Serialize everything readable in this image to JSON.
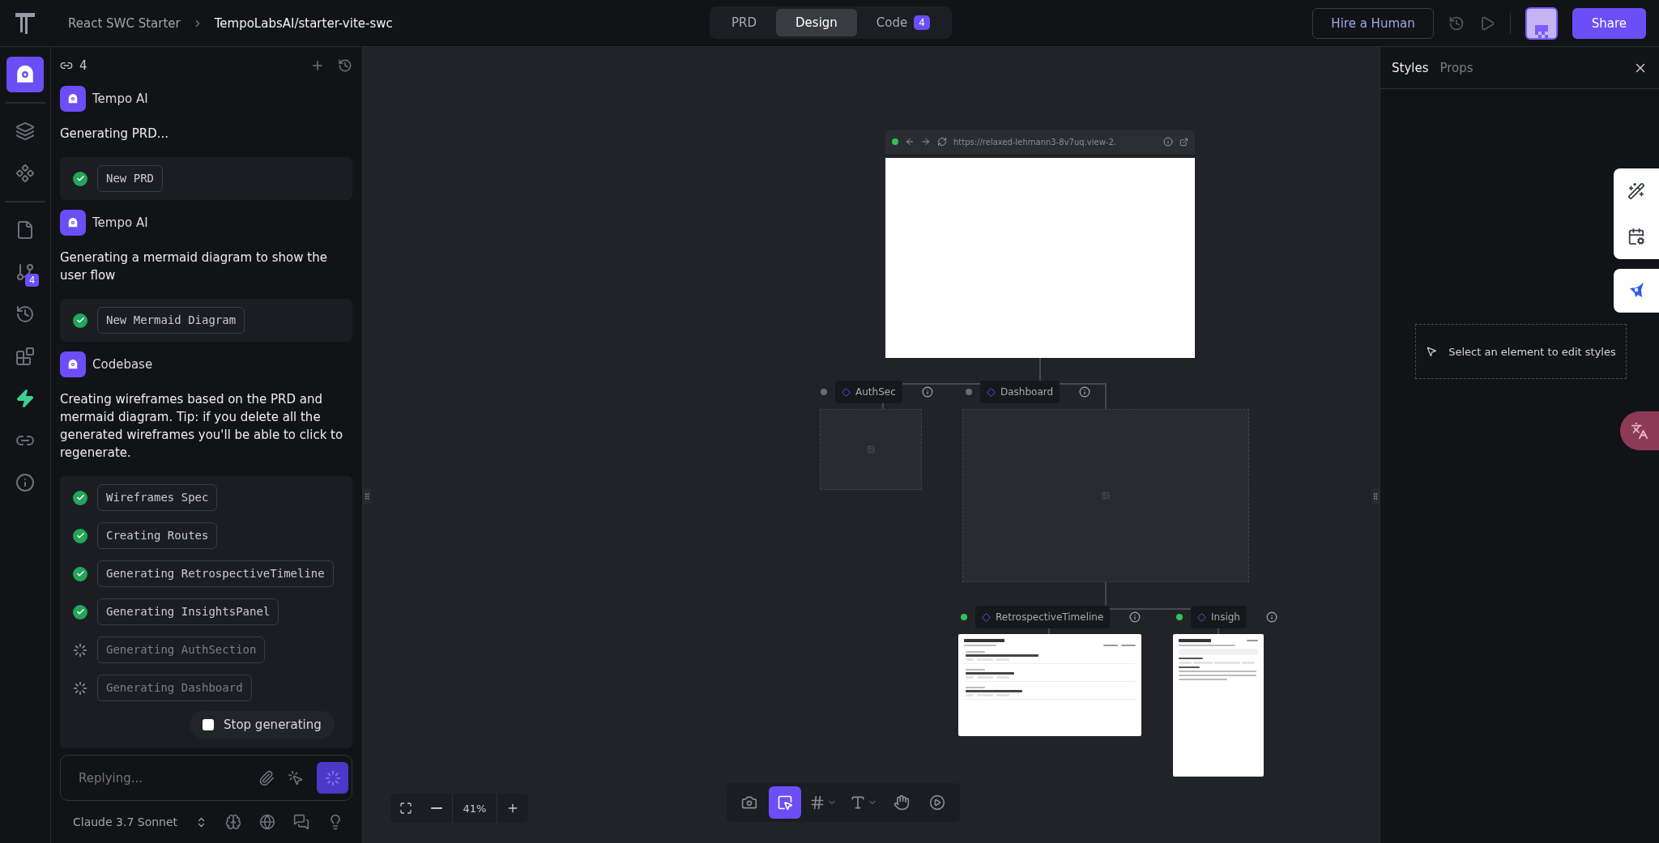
{
  "breadcrumb": [
    "React SWC Starter",
    "TempoLabsAI/starter-vite-swc"
  ],
  "mode_tabs": [
    {
      "label": "PRD",
      "selected": false
    },
    {
      "label": "Design",
      "selected": true
    },
    {
      "label": "Code",
      "selected": false,
      "badge": "4"
    }
  ],
  "header_actions": {
    "hire": "Hire a Human",
    "share": "Share"
  },
  "rail": [
    {
      "selected": true
    },
    {
      "selected": false
    },
    {
      "selected": false
    },
    {
      "selected": false
    },
    {
      "selected": false,
      "badge": "4"
    },
    {
      "selected": false
    },
    {
      "selected": false
    },
    {
      "selected": false
    },
    {
      "selected": false
    },
    {
      "selected": false
    }
  ],
  "chat": {
    "thread_count": "4",
    "messages": [
      {
        "author": "Tempo AI",
        "text": "Generating PRD...",
        "steps": [
          {
            "label": "New PRD",
            "done": true
          }
        ]
      },
      {
        "author": "Tempo AI",
        "text": "Generating a mermaid diagram to show the user flow",
        "steps": [
          {
            "label": "New Mermaid Diagram",
            "done": true
          }
        ]
      },
      {
        "author": "Codebase",
        "text": "Creating wireframes based on the PRD and mermaid diagram. Tip: if you delete all the generated wireframes you'll be able to click to regenerate.",
        "steps": [
          {
            "label": "Wireframes Spec",
            "done": true
          },
          {
            "label": "Creating Routes",
            "done": true
          },
          {
            "label": "Generating RetrospectiveTimeline",
            "done": true
          },
          {
            "label": "Generating InsightsPanel",
            "done": true
          },
          {
            "label": "Generating AuthSection",
            "done": false
          },
          {
            "label": "Generating Dashboard",
            "done": false
          }
        ]
      }
    ],
    "stop_label": "Stop generating",
    "input": {
      "placeholder": "Replying..."
    },
    "model": "Claude 3.7 Sonnet"
  },
  "canvas": {
    "browser": {
      "url": "https://relaxed-lehmann3-8v7uq.view-2."
    },
    "nodes": [
      {
        "name": "AuthSec",
        "ready": false
      },
      {
        "name": "Dashboard",
        "ready": false
      },
      {
        "name": "RetrospectiveTimeline",
        "ready": true
      },
      {
        "name": "Insigh",
        "ready": true
      }
    ],
    "zoom": "41%",
    "tools": [
      {
        "selected": false
      },
      {
        "selected": true
      },
      {
        "selected": false
      },
      {
        "selected": false
      },
      {
        "selected": false
      },
      {
        "selected": false
      }
    ]
  },
  "inspector": {
    "tabs": [
      {
        "label": "Styles",
        "selected": true
      },
      {
        "label": "Props",
        "selected": false
      }
    ],
    "hint": "Select an element to edit styles"
  }
}
